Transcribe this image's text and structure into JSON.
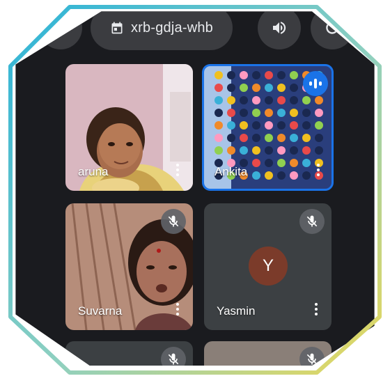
{
  "meeting": {
    "code": "xrb-gdja-whb"
  },
  "participants": [
    {
      "name": "aruna"
    },
    {
      "name": "Ankita"
    },
    {
      "name": "Suvarna"
    },
    {
      "name": "Yasmin",
      "avatar_letter": "Y"
    }
  ],
  "colors": {
    "background": "#1a1b1f",
    "toolbar_button": "#3b3c40",
    "active_speaker_border": "#1a73e8",
    "avatar_bg": "#7b3b2a"
  },
  "icons": [
    "calendar-icon",
    "volume-icon",
    "mic-off-icon",
    "more-vert-icon",
    "speaking-indicator-icon"
  ]
}
